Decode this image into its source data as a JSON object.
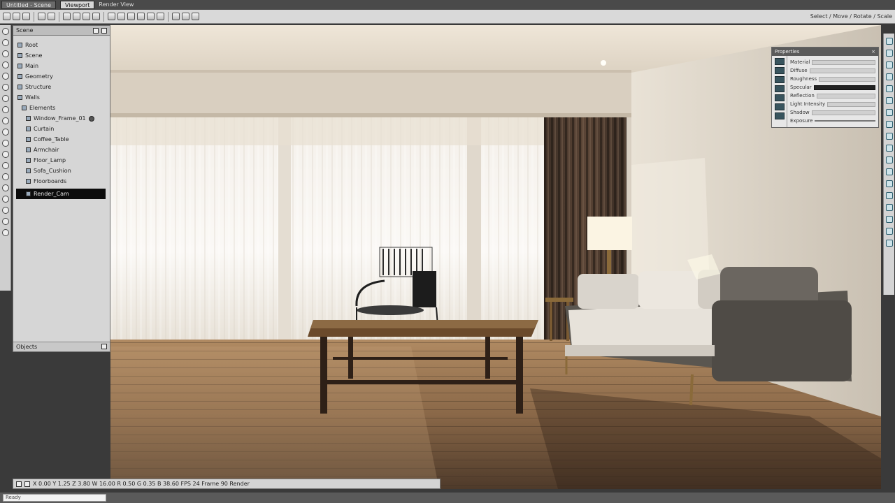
{
  "window": {
    "tabs": [
      "Untitled - Scene",
      "Viewport"
    ],
    "title": "Render View"
  },
  "toolbar": {
    "right_text": "Select / Move / Rotate / Scale"
  },
  "scene_panel": {
    "header_label": "Scene",
    "items": [
      {
        "label": "Root",
        "indent": 0
      },
      {
        "label": "Scene",
        "indent": 0
      },
      {
        "label": "Main",
        "indent": 0
      },
      {
        "label": "Geometry",
        "indent": 0
      },
      {
        "label": "Structure",
        "indent": 0
      },
      {
        "label": "Walls",
        "indent": 0
      },
      {
        "label": "Elements",
        "indent": 1
      },
      {
        "label": "Window_Frame_01",
        "indent": 2
      },
      {
        "label": "Curtain",
        "indent": 2
      },
      {
        "label": "Coffee_Table",
        "indent": 2
      },
      {
        "label": "Armchair",
        "indent": 2
      },
      {
        "label": "Floor_Lamp",
        "indent": 2
      },
      {
        "label": "Sofa_Cushion",
        "indent": 2
      },
      {
        "label": "Floorboards",
        "indent": 2
      }
    ],
    "selected_label": "Render_Cam",
    "footer_label": "Objects"
  },
  "inspector": {
    "title": "Properties",
    "rows": [
      "Material",
      "Diffuse",
      "Roughness",
      "Specular",
      "Reflection",
      "Light Intensity",
      "Shadow",
      "Exposure"
    ]
  },
  "bottom_bar": {
    "text": "X 0.00  Y 1.25  Z 3.80  W 16.00  R 0.50  G 0.35  B 38.60  FPS 24  Frame 90  Render"
  },
  "status": {
    "field": "Ready"
  },
  "colors": {
    "wall": "#ddd6cc",
    "floor": "#8a6a48",
    "curtain_dark": "#4a3a30",
    "sofa": "#5a5650",
    "accent": "#2d5f6e"
  }
}
